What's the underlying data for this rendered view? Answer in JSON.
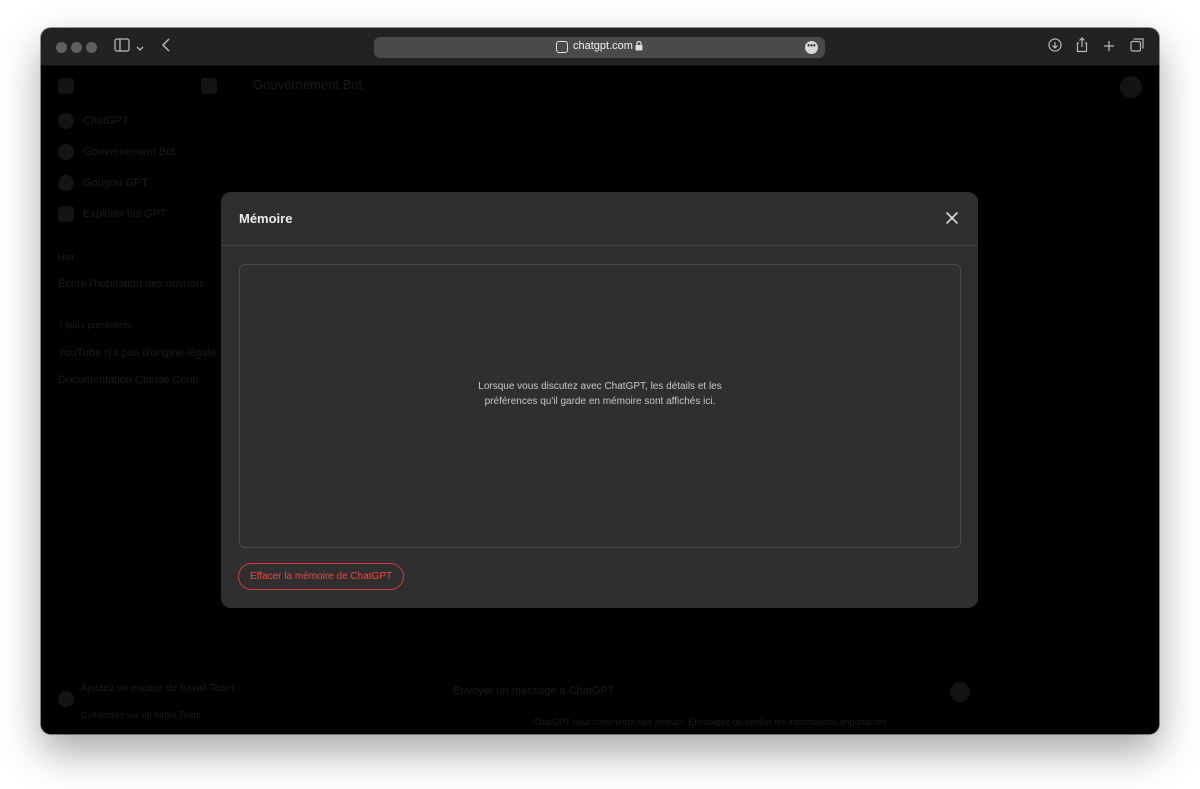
{
  "browser": {
    "url": "chatgpt.com",
    "more_glyph": "•••"
  },
  "background": {
    "sidebar_items": [
      "ChatGPT",
      "Gouvernement Bot",
      "Gougou GPT",
      "Explorer les GPT"
    ],
    "section_label": "Hier",
    "history": [
      "Écrire l'habitation des ouvriers",
      "7 jours précédents",
      "YouTube n'a pas d'origine légale",
      "Documentation Clause Coup"
    ],
    "header_title": "Gouvernement Bot",
    "upgrade_title": "Ajoutez un espace de travail Team",
    "upgrade_sub": "Collaborez sur un forfait Team",
    "composer_placeholder": "Envoyer un message à ChatGPT",
    "footer_note": "ChatGPT peut commettre des erreurs. Envisagez de vérifier les informations importantes."
  },
  "modal": {
    "title": "Mémoire",
    "empty_line1": "Lorsque vous discutez avec ChatGPT, les détails et les",
    "empty_line2": "préférences qu'il garde en mémoire sont affichés ici.",
    "clear_button": "Effacer la mémoire de ChatGPT"
  },
  "colors": {
    "modal_bg": "#2f2f2f",
    "danger": "#ef4444",
    "toolbar_bg": "#222222"
  }
}
